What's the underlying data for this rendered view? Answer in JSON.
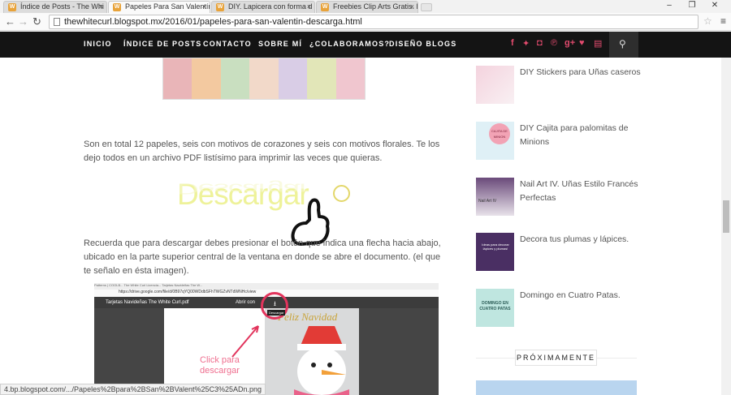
{
  "browser": {
    "tabs": [
      {
        "label": "Índice de Posts - The Whi",
        "active": false
      },
      {
        "label": "Papeles Para San Valentín",
        "active": true
      },
      {
        "label": "DIY. Lapicera con forma d",
        "active": false
      },
      {
        "label": "Freebies Clip Arts Gratis. E",
        "active": false
      }
    ],
    "tab_favicon": "W",
    "url": "thewhitecurl.blogspot.mx/2016/01/papeles-para-san-valentin-descarga.html",
    "status_url": "4.bp.blogspot.com/.../Papeles%2Bpara%2BSan%2BValent%25C3%25ADn.png"
  },
  "site_nav": {
    "items": [
      "INICIO",
      "ÍNDICE DE POSTS",
      "CONTACTO",
      "SOBRE MÍ",
      "¿COLABORAMOS?",
      "DISEÑO BLOGS"
    ],
    "social_icons": [
      "facebook-icon",
      "twitter-icon",
      "instagram-icon",
      "pinterest-icon",
      "google-plus-icon",
      "heart-icon",
      "book-icon"
    ],
    "accent_color": "#e24b6e"
  },
  "post": {
    "paragraph1": "Son en total 12 papeles, seis con motivos de corazones y seis con motivos florales. Te los dejo todos en un archivo PDF listísimo para imprimir las veces que quieras.",
    "download_label": "Descargar",
    "paragraph2": "Recuerda que para descargar debes presionar el botón que indica una flecha hacia abajo, ubicado en la parte superior central de la ventana en donde se abre el documento. (el que te señalo en ésta imagen).",
    "screenshot": {
      "tabs_text": "Patterns | COOLB... The White Curl Licencia... Tarjetas Navideñas The W...",
      "url_text": "https://drive.google.com/file/d/0B97qYQ00WDdbSFhTWGZvNTdWNHc/view",
      "doc_title": "Tarjetas Navideñas The White Curl.pdf",
      "open_with": "Abrir con",
      "tooltip": "Descargar",
      "card_title": "Feliz Navidad",
      "callout_line1": "Click para",
      "callout_line2": "descargar"
    }
  },
  "sidebar": {
    "items": [
      {
        "title": "DIY Stickers para Uñas caseros"
      },
      {
        "title": "DIY Cajita para palomitas de Minions",
        "thumb_text": "CAJITA DE MINION"
      },
      {
        "title": "Nail Art IV. Uñas Estilo Francés Perfectas",
        "thumb_text": "Nail Art IV"
      },
      {
        "title": "Decora tus plumas y lápices.",
        "thumb_text": "Ideas para decorar lápices y plumas!"
      },
      {
        "title": "Domingo en Cuatro Patas.",
        "thumb_text": "DOMINGO EN CUATRO PATAS"
      }
    ],
    "section_heading": "PRÓXIMAMENTE"
  }
}
